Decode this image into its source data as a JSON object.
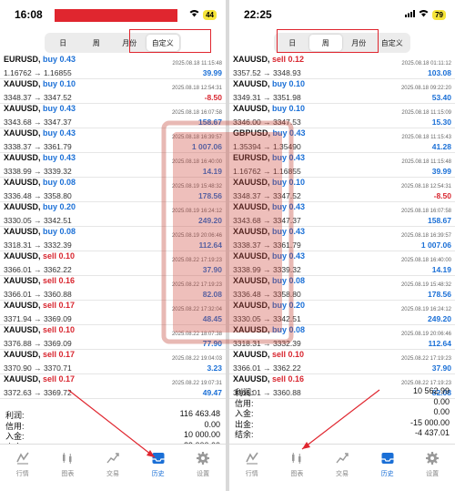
{
  "left": {
    "time": "16:08",
    "battery": "44",
    "tabs": [
      "日",
      "周",
      "月份",
      "自定义"
    ],
    "active_tab": 3,
    "trades": [
      {
        "sym": "EURUSD",
        "side": "buy",
        "lot": "0.43",
        "dt": "2025.08.18 11:15:48",
        "px": "1.16762 → 1.16855",
        "pl": "39.99"
      },
      {
        "sym": "XAUUSD",
        "side": "buy",
        "lot": "0.10",
        "dt": "2025.08.18 12:54:31",
        "px": "3348.37 → 3347.52",
        "pl": "-8.50"
      },
      {
        "sym": "XAUUSD",
        "side": "buy",
        "lot": "0.43",
        "dt": "2025.08.18 16:07:58",
        "px": "3343.68 → 3347.37",
        "pl": "158.67"
      },
      {
        "sym": "XAUUSD",
        "side": "buy",
        "lot": "0.43",
        "dt": "2025.08.18 16:39:57",
        "px": "3338.37 → 3361.79",
        "pl": "1 007.06"
      },
      {
        "sym": "XAUUSD",
        "side": "buy",
        "lot": "0.43",
        "dt": "2025.08.18 16:40:00",
        "px": "3338.99 → 3339.32",
        "pl": "14.19"
      },
      {
        "sym": "XAUUSD",
        "side": "buy",
        "lot": "0.08",
        "dt": "2025.08.19 15:48:32",
        "px": "3336.48 → 3358.80",
        "pl": "178.56"
      },
      {
        "sym": "XAUUSD",
        "side": "buy",
        "lot": "0.20",
        "dt": "2025.08.19 16:24:12",
        "px": "3330.05 → 3342.51",
        "pl": "249.20"
      },
      {
        "sym": "XAUUSD",
        "side": "buy",
        "lot": "0.08",
        "dt": "2025.08.19 20:06:46",
        "px": "3318.31 → 3332.39",
        "pl": "112.64"
      },
      {
        "sym": "XAUUSD",
        "side": "sell",
        "lot": "0.10",
        "dt": "2025.08.22 17:19:23",
        "px": "3366.01 → 3362.22",
        "pl": "37.90"
      },
      {
        "sym": "XAUUSD",
        "side": "sell",
        "lot": "0.16",
        "dt": "2025.08.22 17:19:23",
        "px": "3366.01 → 3360.88",
        "pl": "82.08"
      },
      {
        "sym": "XAUUSD",
        "side": "sell",
        "lot": "0.17",
        "dt": "2025.08.22 17:32:04",
        "px": "3371.94 → 3369.09",
        "pl": "48.45"
      },
      {
        "sym": "XAUUSD",
        "side": "sell",
        "lot": "0.10",
        "dt": "2025.08.22 18:07:38",
        "px": "3376.88 → 3369.09",
        "pl": "77.90"
      },
      {
        "sym": "XAUUSD",
        "side": "sell",
        "lot": "0.17",
        "dt": "2025.08.22 19:04:03",
        "px": "3370.90 → 3370.71",
        "pl": "3.23"
      },
      {
        "sym": "XAUUSD",
        "side": "sell",
        "lot": "0.17",
        "dt": "2025.08.22 19:07:31",
        "px": "3372.63 → 3369.72",
        "pl": "49.47"
      }
    ],
    "summary": [
      {
        "label": "利润:",
        "value": "116 463.48"
      },
      {
        "label": "信用:",
        "value": "0.00"
      },
      {
        "label": "入金:",
        "value": "10 000.00"
      },
      {
        "label": "出金:",
        "value": "-29 000.00"
      },
      {
        "label": "结余:",
        "value": "97 463.48"
      }
    ]
  },
  "right": {
    "time": "22:25",
    "battery": "79",
    "tabs": [
      "日",
      "周",
      "月份",
      "自定义"
    ],
    "active_tab": 1,
    "trades": [
      {
        "sym": "XAUUSD",
        "side": "sell",
        "lot": "0.12",
        "dt": "2025.08.18 01:11:12",
        "px": "3357.52 → 3348.93",
        "pl": "103.08"
      },
      {
        "sym": "XAUUSD",
        "side": "buy",
        "lot": "0.10",
        "dt": "2025.08.18 09:22:20",
        "px": "3349.31 → 3351.98",
        "pl": "53.40"
      },
      {
        "sym": "XAUUSD",
        "side": "buy",
        "lot": "0.10",
        "dt": "2025.08.18 11:15:09",
        "px": "3346.00 → 3347.53",
        "pl": "15.30"
      },
      {
        "sym": "GBPUSD",
        "side": "buy",
        "lot": "0.43",
        "dt": "2025.08.18 11:15:43",
        "px": "1.35394 → 1.35490",
        "pl": "41.28"
      },
      {
        "sym": "EURUSD",
        "side": "buy",
        "lot": "0.43",
        "dt": "2025.08.18 11:15:48",
        "px": "1.16762 → 1.16855",
        "pl": "39.99"
      },
      {
        "sym": "XAUUSD",
        "side": "buy",
        "lot": "0.10",
        "dt": "2025.08.18 12:54:31",
        "px": "3348.37 → 3347.52",
        "pl": "-8.50"
      },
      {
        "sym": "XAUUSD",
        "side": "buy",
        "lot": "0.43",
        "dt": "2025.08.18 16:07:58",
        "px": "3343.68 → 3347.37",
        "pl": "158.67"
      },
      {
        "sym": "XAUUSD",
        "side": "buy",
        "lot": "0.43",
        "dt": "2025.08.18 16:39:57",
        "px": "3338.37 → 3361.79",
        "pl": "1 007.06"
      },
      {
        "sym": "XAUUSD",
        "side": "buy",
        "lot": "0.43",
        "dt": "2025.08.18 16:40:00",
        "px": "3338.99 → 3339.32",
        "pl": "14.19"
      },
      {
        "sym": "XAUUSD",
        "side": "buy",
        "lot": "0.08",
        "dt": "2025.08.19 15:48:32",
        "px": "3336.48 → 3358.80",
        "pl": "178.56"
      },
      {
        "sym": "XAUUSD",
        "side": "buy",
        "lot": "0.20",
        "dt": "2025.08.19 16:24:12",
        "px": "3330.05 → 3342.51",
        "pl": "249.20"
      },
      {
        "sym": "XAUUSD",
        "side": "buy",
        "lot": "0.08",
        "dt": "2025.08.19 20:06:46",
        "px": "3318.31 → 3332.39",
        "pl": "112.64"
      },
      {
        "sym": "XAUUSD",
        "side": "sell",
        "lot": "0.10",
        "dt": "2025.08.22 17:19:23",
        "px": "3366.01 → 3362.22",
        "pl": "37.90"
      },
      {
        "sym": "XAUUSD",
        "side": "sell",
        "lot": "0.16",
        "dt": "2025.08.22 17:19:23",
        "px": "3366.01 → 3360.88",
        "pl": "82.08"
      }
    ],
    "summary": [
      {
        "label": "利润:",
        "value": "10 562.99"
      },
      {
        "label": "信用:",
        "value": "0.00"
      },
      {
        "label": "入金:",
        "value": "0.00"
      },
      {
        "label": "出金:",
        "value": "-15 000.00"
      },
      {
        "label": "结余:",
        "value": "-4 437.01"
      }
    ]
  },
  "tabbar": [
    {
      "label": "行情",
      "icon": "quotes-icon"
    },
    {
      "label": "图表",
      "icon": "chart-icon"
    },
    {
      "label": "交易",
      "icon": "trade-icon"
    },
    {
      "label": "历史",
      "icon": "history-icon"
    },
    {
      "label": "设置",
      "icon": "settings-icon"
    }
  ],
  "active_bottom_tab": 3,
  "colors": {
    "buy": "#1a6fd6",
    "sell": "#d8262f",
    "annotation": "#e0262f"
  }
}
